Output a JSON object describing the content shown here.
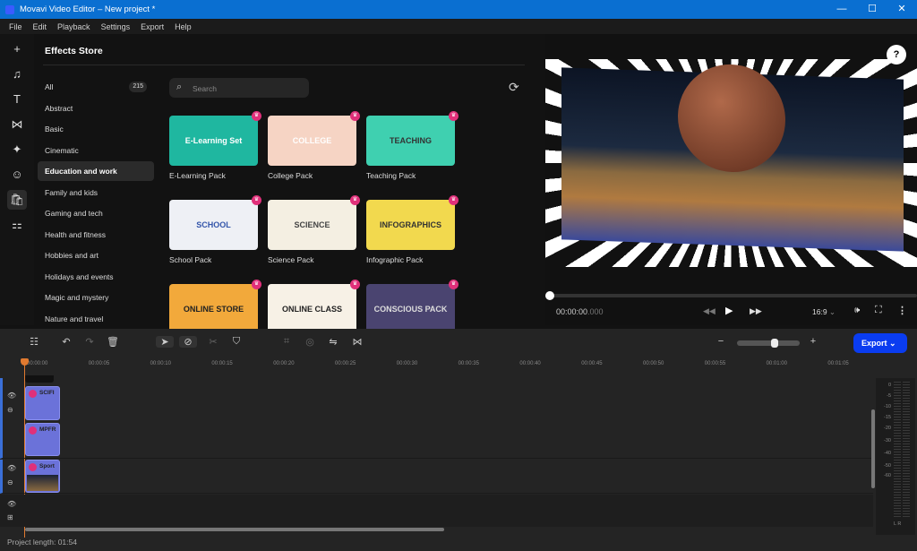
{
  "window": {
    "title": "Movavi Video Editor – New project *",
    "controls": [
      "—",
      "☐",
      "✕"
    ]
  },
  "menu": [
    "File",
    "Edit",
    "Playback",
    "Settings",
    "Export",
    "Help"
  ],
  "leftbar": [
    {
      "icon": "plus-icon",
      "glyph": "+"
    },
    {
      "icon": "music-icon",
      "glyph": "♫"
    },
    {
      "icon": "text-icon",
      "glyph": "T"
    },
    {
      "icon": "transitions-icon",
      "glyph": "⋈"
    },
    {
      "icon": "magic-icon",
      "glyph": "✦"
    },
    {
      "icon": "sticker-icon",
      "glyph": "☺"
    },
    {
      "icon": "store-icon",
      "glyph": "🛍",
      "active": true
    },
    {
      "icon": "more-tools-icon",
      "glyph": "⚏"
    }
  ],
  "store": {
    "title": "Effects Store",
    "search_placeholder": "Search",
    "categories": [
      {
        "label": "All",
        "count": "215"
      },
      {
        "label": "Abstract"
      },
      {
        "label": "Basic"
      },
      {
        "label": "Cinematic"
      },
      {
        "label": "Education and work",
        "active": true
      },
      {
        "label": "Family and kids"
      },
      {
        "label": "Gaming and tech"
      },
      {
        "label": "Health and fitness"
      },
      {
        "label": "Hobbies and art"
      },
      {
        "label": "Holidays and events"
      },
      {
        "label": "Magic and mystery"
      },
      {
        "label": "Nature and travel"
      }
    ],
    "packs": [
      {
        "label": "E-Learning Pack",
        "thumb_text": "E-Learning Set",
        "bg": "#1fb7a0",
        "fg": "#fff"
      },
      {
        "label": "College Pack",
        "thumb_text": "COLLEGE",
        "bg": "#f6d4c4",
        "fg": "#fff"
      },
      {
        "label": "Teaching Pack",
        "thumb_text": "TEACHING",
        "bg": "#3fd0b0",
        "fg": "#333"
      },
      {
        "label": "School Pack",
        "thumb_text": "SCHOOL",
        "bg": "#eef0f5",
        "fg": "#3355aa"
      },
      {
        "label": "Science Pack",
        "thumb_text": "SCIENCE",
        "bg": "#f4efe2",
        "fg": "#444"
      },
      {
        "label": "Infographic Pack",
        "thumb_text": "INFOGRAPHICS",
        "bg": "#f2d94e",
        "fg": "#333"
      },
      {
        "label": "",
        "thumb_text": "ONLINE STORE",
        "bg": "#f2a93b",
        "fg": "#222"
      },
      {
        "label": "",
        "thumb_text": "ONLINE CLASS",
        "bg": "#f7f1e6",
        "fg": "#222"
      },
      {
        "label": "",
        "thumb_text": "CONSCIOUS PACK",
        "bg": "#4a4470",
        "fg": "#ddd"
      }
    ]
  },
  "player": {
    "time": "00:00:00",
    "time_ms": ".000",
    "aspect": "16:9",
    "progress": 0
  },
  "timeline": {
    "export_label": "Export",
    "project_length": "Project length: 01:54",
    "ticks": [
      "00:00:00",
      "00:00:05",
      "00:00:10",
      "00:00:15",
      "00:00:20",
      "00:00:25",
      "00:00:30",
      "00:00:35",
      "00:00:40",
      "00:00:45",
      "00:00:50",
      "00:00:55",
      "00:01:00",
      "00:01:05"
    ],
    "clips": [
      "SCIFI",
      "MPFR",
      "Sport"
    ],
    "meter": [
      "0",
      "-5",
      "-10",
      "-15",
      "-20",
      "-30",
      "-40",
      "-50",
      "-60"
    ],
    "meter_channels": "L  R"
  },
  "colors": {
    "accent": "#0a3cf0",
    "titlebar": "#0a6fd1",
    "crown": "#e0307a",
    "clip": "#6b72d9"
  }
}
